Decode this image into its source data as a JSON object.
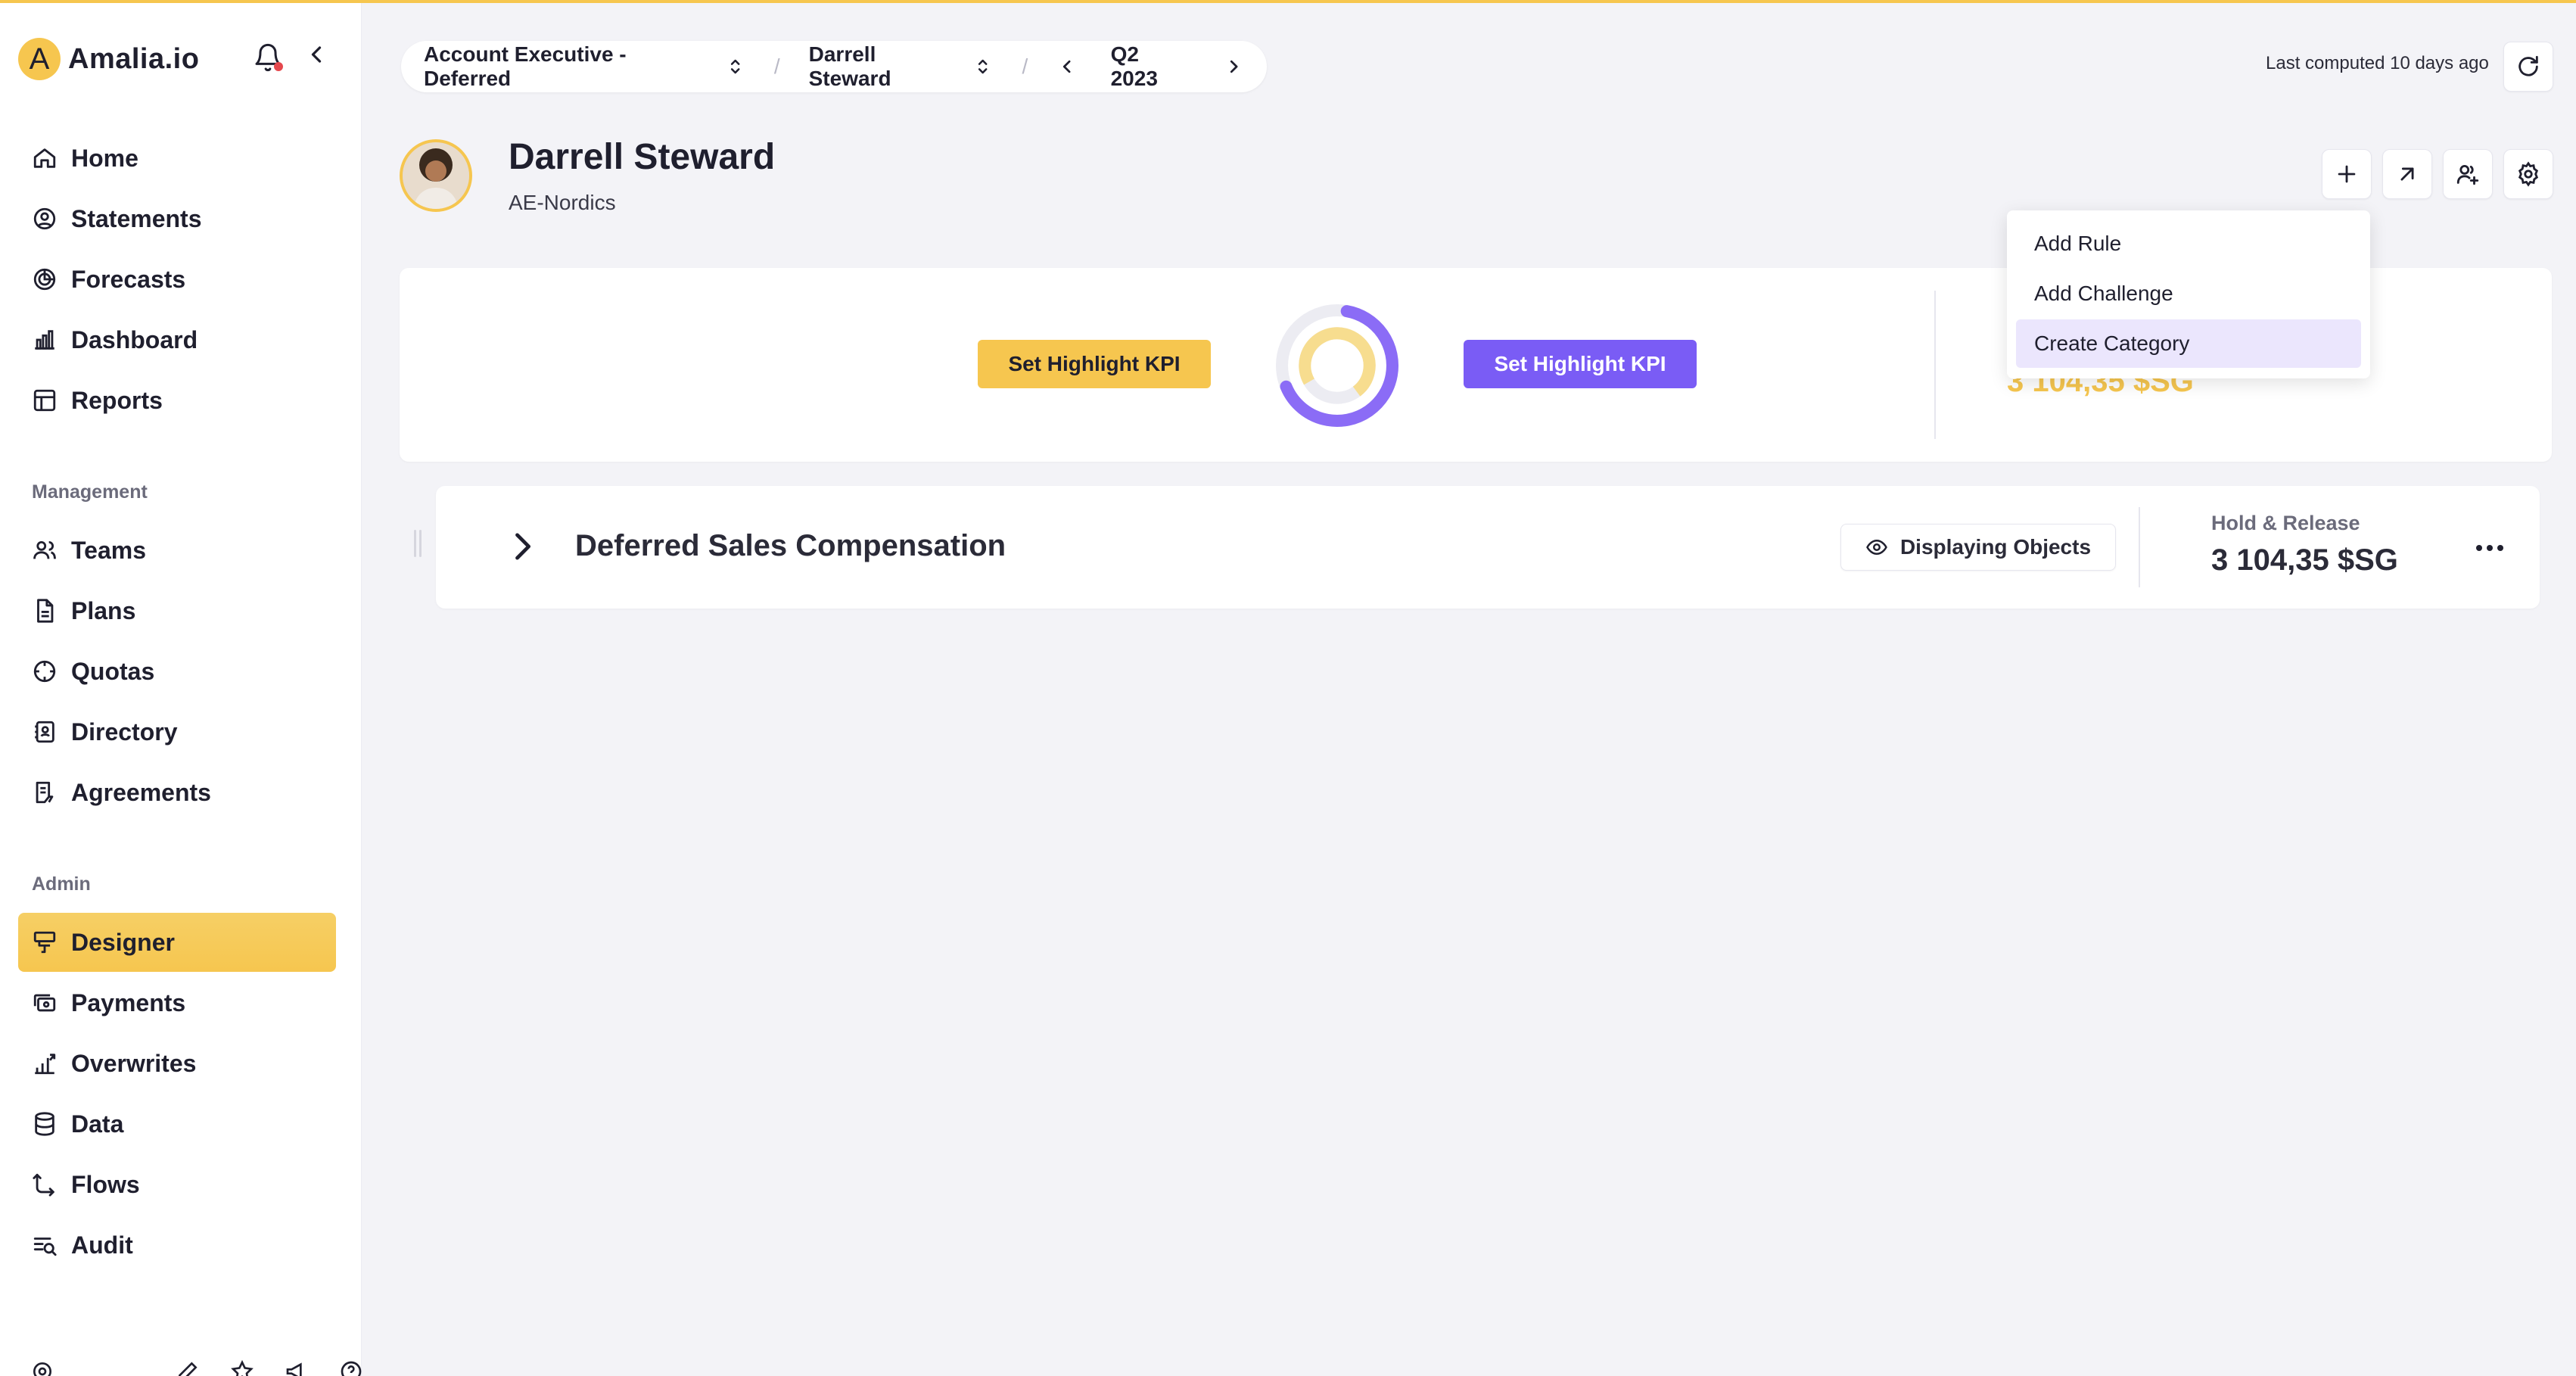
{
  "app": {
    "brand_letter": "A",
    "brand_name": "Amalia.io"
  },
  "sidebar": {
    "main_items": [
      {
        "label": "Home",
        "icon": "home-icon"
      },
      {
        "label": "Statements",
        "icon": "statements-icon"
      },
      {
        "label": "Forecasts",
        "icon": "forecasts-icon"
      },
      {
        "label": "Dashboard",
        "icon": "dashboard-icon"
      },
      {
        "label": "Reports",
        "icon": "reports-icon"
      }
    ],
    "management_label": "Management",
    "management_items": [
      {
        "label": "Teams",
        "icon": "teams-icon"
      },
      {
        "label": "Plans",
        "icon": "plans-icon"
      },
      {
        "label": "Quotas",
        "icon": "quotas-icon"
      },
      {
        "label": "Directory",
        "icon": "directory-icon"
      },
      {
        "label": "Agreements",
        "icon": "agreements-icon"
      }
    ],
    "admin_label": "Admin",
    "admin_items": [
      {
        "label": "Designer",
        "icon": "designer-icon",
        "active": true
      },
      {
        "label": "Payments",
        "icon": "payments-icon"
      },
      {
        "label": "Overwrites",
        "icon": "overwrites-icon"
      },
      {
        "label": "Data",
        "icon": "data-icon"
      },
      {
        "label": "Flows",
        "icon": "flows-icon"
      },
      {
        "label": "Audit",
        "icon": "audit-icon"
      }
    ]
  },
  "breadcrumb": {
    "plan": "Account Executive - Deferred",
    "user": "Darrell Steward",
    "period": "Q2 2023"
  },
  "header": {
    "last_computed": "Last computed 10 days ago"
  },
  "profile": {
    "name": "Darrell Steward",
    "team": "AE-Nordics"
  },
  "kpi": {
    "set_highlight_left": "Set Highlight KPI",
    "set_highlight_right": "Set Highlight KPI",
    "value": "3 104,35 $SG"
  },
  "dropdown": {
    "items": [
      "Add Rule",
      "Add Challenge",
      "Create Category"
    ],
    "hovered": "Create Category"
  },
  "plan_row": {
    "title": "Deferred Sales Compensation",
    "display_button": "Displaying Objects",
    "metric_label": "Hold & Release",
    "metric_value": "3 104,35 $SG"
  },
  "colors": {
    "accent_yellow": "#f6c64f",
    "accent_purple": "#7a5cf5",
    "notification_red": "#e5484d"
  }
}
